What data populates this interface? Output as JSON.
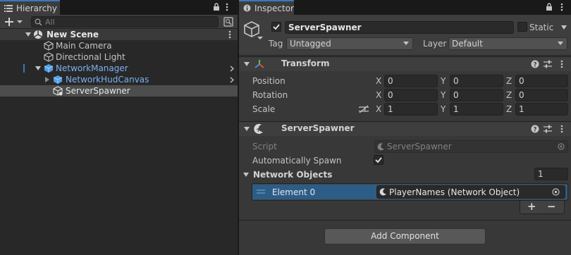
{
  "hierarchy": {
    "tab_label": "Hierarchy",
    "search_placeholder": "All",
    "scene": {
      "name": "New Scene"
    },
    "items": [
      {
        "label": "Main Camera"
      },
      {
        "label": "Directional Light"
      },
      {
        "label": "NetworkManager"
      },
      {
        "label": "NetworkHudCanvas"
      },
      {
        "label": "ServerSpawner"
      }
    ]
  },
  "inspector": {
    "tab_label": "Inspector",
    "object": {
      "name": "ServerSpawner",
      "active": true,
      "static_label": "Static",
      "tag_label": "Tag",
      "tag_value": "Untagged",
      "layer_label": "Layer",
      "layer_value": "Default"
    },
    "transform": {
      "title": "Transform",
      "rows": [
        {
          "label": "Position",
          "x": "0",
          "y": "0",
          "z": "0"
        },
        {
          "label": "Rotation",
          "x": "0",
          "y": "0",
          "z": "0"
        },
        {
          "label": "Scale",
          "x": "1",
          "y": "1",
          "z": "1"
        }
      ],
      "axis_labels": {
        "x": "X",
        "y": "Y",
        "z": "Z"
      }
    },
    "server_spawner": {
      "title": "ServerSpawner",
      "script_label": "Script",
      "script_value": "ServerSpawner",
      "auto_spawn_label": "Automatically Spawn",
      "auto_spawn_checked": true,
      "network_objects_label": "Network Objects",
      "network_objects_count": "1",
      "element_label": "Element 0",
      "element_value": "PlayerNames (Network Object)",
      "add_label": "+",
      "remove_label": "−"
    },
    "add_component_label": "Add Component"
  },
  "colors": {
    "accent": "#3a79bb",
    "selection": "#2c5d87",
    "prefab_blue": "#7bb1f0"
  }
}
